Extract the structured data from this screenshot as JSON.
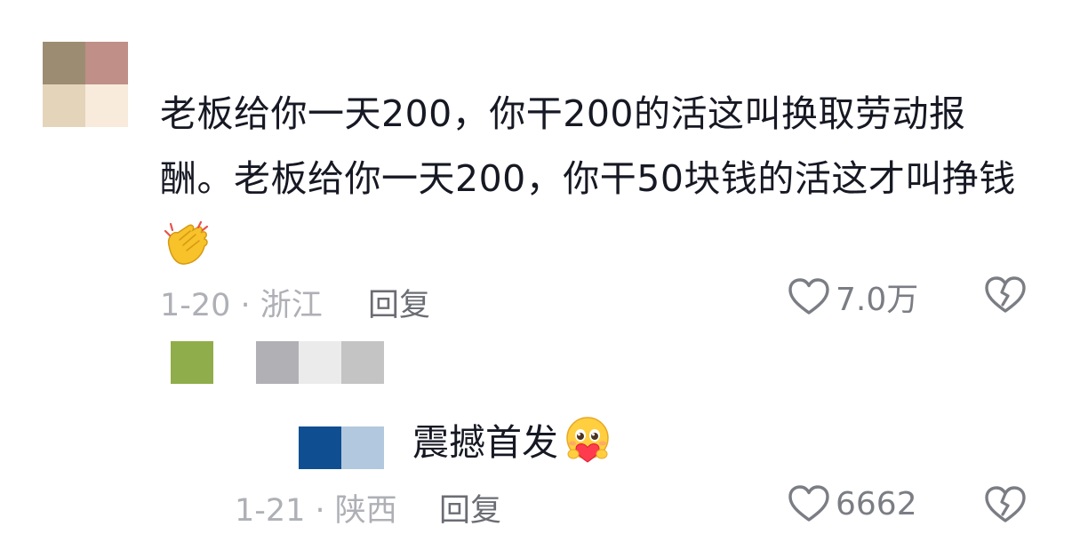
{
  "comment": {
    "avatar_colors": [
      "#9c8d72",
      "#bf8f88",
      "#e3d4ba",
      "#f8ebdb"
    ],
    "text": "老板给你一天200，你干200的活这叫换取劳动报酬。老板给你一天200，你干50块钱的活这才叫挣钱",
    "emoji": "clapping-hands-icon",
    "date_location": "1-20 · 浙江",
    "reply_label": "回复",
    "like_count": "7.0万"
  },
  "reply_header": {
    "blur_colors": [
      "#8fad4a",
      "#ffffff",
      "#b1b0b5",
      "#ebebeb",
      "#c3c4c3"
    ]
  },
  "reply": {
    "avatar_colors": [
      "#ffffff",
      "#0f4f91",
      "#b2c8de"
    ],
    "text": "震撼首发",
    "emoji": "hugging-face-icon",
    "date_location": "1-21 · 陕西",
    "reply_label": "回复",
    "like_count": "6662"
  }
}
